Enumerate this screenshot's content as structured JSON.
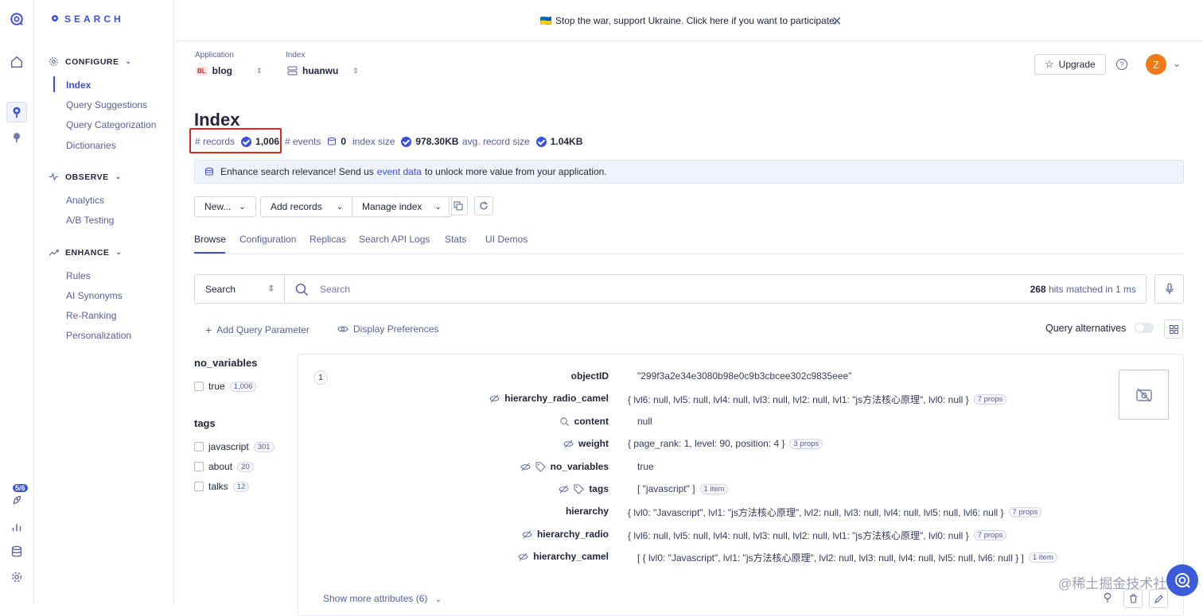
{
  "banner": {
    "flag": "🇺🇦",
    "text": "Stop the war, support Ukraine. Click here if you want to participate.",
    "close": "✕"
  },
  "brand": {
    "name": "SEARCH"
  },
  "rail": {
    "badge": "5/6"
  },
  "sidebar": {
    "configure": {
      "title": "CONFIGURE",
      "items": [
        "Index",
        "Query Suggestions",
        "Query Categorization",
        "Dictionaries"
      ]
    },
    "observe": {
      "title": "OBSERVE",
      "items": [
        "Analytics",
        "A/B Testing"
      ]
    },
    "enhance": {
      "title": "ENHANCE",
      "items": [
        "Rules",
        "AI Synonyms",
        "Re-Ranking",
        "Personalization"
      ]
    }
  },
  "header": {
    "application_label": "Application",
    "application_badge": "BL",
    "application_value": "blog",
    "index_label": "Index",
    "index_value": "huanwu",
    "upgrade": "Upgrade",
    "avatar": "Z"
  },
  "page": {
    "title": "Index"
  },
  "stats": {
    "records_label": "# records",
    "records": "1,006",
    "events_label": "# events",
    "events": "0",
    "size_label": "index size",
    "size": "978.30KB",
    "avg_label": "avg. record size",
    "avg": "1.04KB"
  },
  "info": {
    "pre": "Enhance search relevance! Send us",
    "link": "event data",
    "post": "to unlock more value from your application."
  },
  "actions": {
    "new": "New...",
    "add": "Add records",
    "manage": "Manage index"
  },
  "tabs": [
    "Browse",
    "Configuration",
    "Replicas",
    "Search API Logs",
    "Stats",
    "UI Demos"
  ],
  "search": {
    "type": "Search",
    "placeholder": "Search",
    "hits": "268",
    "hits_suffix": "hits matched in 1 ms"
  },
  "links": {
    "add_param": "Add Query Parameter",
    "display": "Display Preferences",
    "alternatives": "Query alternatives"
  },
  "facets": {
    "no_variables": {
      "title": "no_variables",
      "items": [
        {
          "label": "true",
          "count": "1,006"
        }
      ]
    },
    "tags": {
      "title": "tags",
      "items": [
        {
          "label": "javascript",
          "count": "301"
        },
        {
          "label": "about",
          "count": "20"
        },
        {
          "label": "talks",
          "count": "12"
        }
      ]
    }
  },
  "record": {
    "num": "1",
    "attributes": [
      {
        "name": "objectID",
        "value": "\"299f3a2e34e3080b98e0c9b3cbcee302c9835eee\"",
        "meta": ""
      },
      {
        "name": "hierarchy_radio_camel",
        "value": "{ lvl6: null, lvl5: null, lvl4: null, lvl3: null, lvl2: null, lvl1: \"js方法核心原理\", lvl0: null }",
        "meta": "7 props"
      },
      {
        "name": "content",
        "value": "null",
        "meta": ""
      },
      {
        "name": "weight",
        "value": "{ page_rank: 1, level: 90, position: 4 }",
        "meta": "3 props"
      },
      {
        "name": "no_variables",
        "value": "true",
        "meta": ""
      },
      {
        "name": "tags",
        "value": "[ \"javascript\" ]",
        "meta": "1 item"
      },
      {
        "name": "hierarchy",
        "value": "{ lvl0: \"Javascript\", lvl1: \"js方法核心原理\", lvl2: null, lvl3: null, lvl4: null, lvl5: null, lvl6: null }",
        "meta": "7 props"
      },
      {
        "name": "hierarchy_radio",
        "value": "{ lvl6: null, lvl5: null, lvl4: null, lvl3: null, lvl2: null, lvl1: \"js方法核心原理\", lvl0: null }",
        "meta": "7 props"
      },
      {
        "name": "hierarchy_camel",
        "value": "[ { lvl0: \"Javascript\", lvl1: \"js方法核心原理\", lvl2: null, lvl3: null, lvl4: null, lvl5: null, lvl6: null } ]",
        "meta": "1 item"
      }
    ],
    "show_more": "Show more attributes (6)"
  },
  "watermark": "@稀土掘金技术社区"
}
